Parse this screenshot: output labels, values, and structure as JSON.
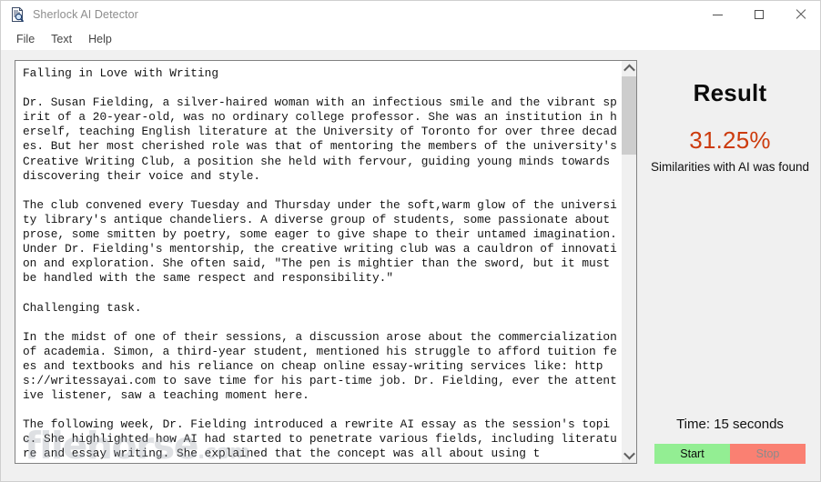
{
  "window": {
    "title": "Sherlock AI Detector",
    "icon": "document-magnifier-icon",
    "minimize_label": "Minimize",
    "maximize_label": "Maximize",
    "close_label": "Close"
  },
  "menubar": {
    "items": [
      {
        "label": "File"
      },
      {
        "label": "Text"
      },
      {
        "label": "Help"
      }
    ]
  },
  "editor": {
    "content": "Falling in Love with Writing\n\nDr. Susan Fielding, a silver-haired woman with an infectious smile and the vibrant spirit of a 20-year-old, was no ordinary college professor. She was an institution in herself, teaching English literature at the University of Toronto for over three decades. But her most cherished role was that of mentoring the members of the university's Creative Writing Club, a position she held with fervour, guiding young minds towards discovering their voice and style.\n\nThe club convened every Tuesday and Thursday under the soft,warm glow of the university library's antique chandeliers. A diverse group of students, some passionate about prose, some smitten by poetry, some eager to give shape to their untamed imagination. Under Dr. Fielding's mentorship, the creative writing club was a cauldron of innovation and exploration. She often said, \"The pen is mightier than the sword, but it must be handled with the same respect and responsibility.\"\n\nChallenging task.\n\nIn the midst of one of their sessions, a discussion arose about the commercialization of academia. Simon, a third-year student, mentioned his struggle to afford tuition fees and textbooks and his reliance on cheap online essay-writing services like: https://writessayai.com to save time for his part-time job. Dr. Fielding, ever the attentive listener, saw a teaching moment here.\n\nThe following week, Dr. Fielding introduced a rewrite AI essay as the session's topic. She highlighted how AI had started to penetrate various fields, including literature and essay writing. She explained that the concept was all about using t",
    "scrollbar": {
      "up_arrow": "chevron-up-icon",
      "down_arrow": "chevron-down-icon"
    }
  },
  "watermark": {
    "name": "filehorse",
    "suffix": ".com"
  },
  "result": {
    "title": "Result",
    "percentage": "31.25%",
    "percentage_color": "#cc3b0d",
    "description": "Similarities with AI was found"
  },
  "controls": {
    "time_label": "Time: 15 seconds",
    "start_label": "Start",
    "stop_label": "Stop",
    "start_color": "#93ee93",
    "stop_color": "#fa8072"
  }
}
